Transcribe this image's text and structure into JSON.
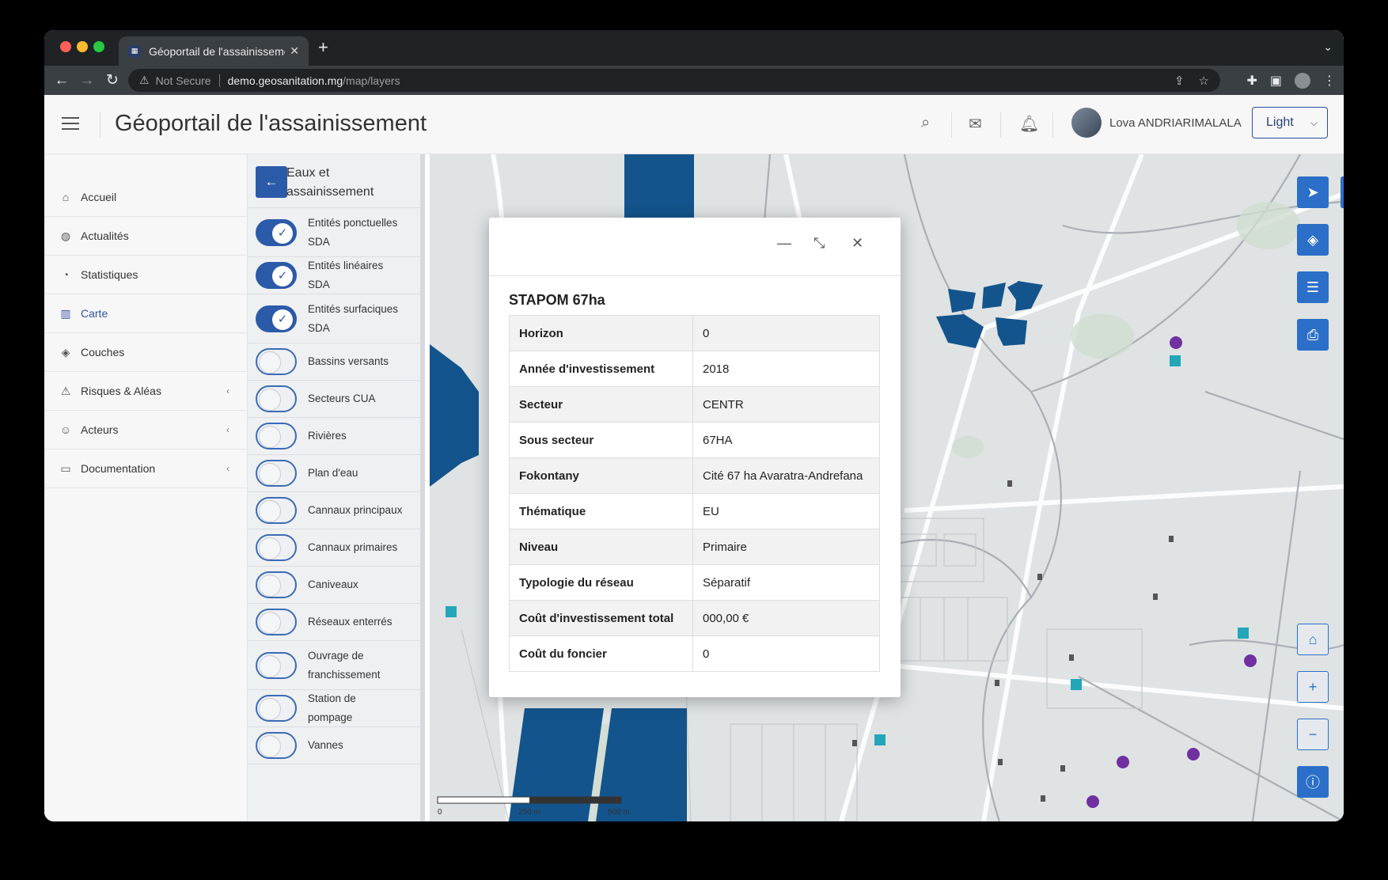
{
  "browser": {
    "tab_title": "Géoportail de l'assainissement",
    "security": "Not Secure",
    "url_host": "demo.geosanitation.mg",
    "url_path": "/map/layers"
  },
  "header": {
    "title": "Géoportail de l'assainissement",
    "user_name": "Lova ANDRIARIMALALA",
    "theme_label": "Light"
  },
  "sidebar": {
    "items": [
      {
        "label": "Accueil",
        "icon": "home-icon"
      },
      {
        "label": "Actualités",
        "icon": "globe-icon"
      },
      {
        "label": "Statistiques",
        "icon": "pie-chart-icon"
      },
      {
        "label": "Carte",
        "icon": "map-icon",
        "active": true
      },
      {
        "label": "Couches",
        "icon": "layers-icon"
      },
      {
        "label": "Risques & Aléas",
        "icon": "warning-icon",
        "expandable": true
      },
      {
        "label": "Acteurs",
        "icon": "users-icon",
        "expandable": true
      },
      {
        "label": "Documentation",
        "icon": "book-icon",
        "expandable": true
      }
    ]
  },
  "layer_panel": {
    "title": "Eaux et assainissement",
    "layers": [
      {
        "label": "Entités ponctuelles SDA",
        "enabled": true
      },
      {
        "label": "Entités linéaires SDA",
        "enabled": true
      },
      {
        "label": "Entités surfaciques SDA",
        "enabled": true
      },
      {
        "label": "Bassins versants",
        "enabled": false
      },
      {
        "label": "Secteurs CUA",
        "enabled": false
      },
      {
        "label": "Rivières",
        "enabled": false
      },
      {
        "label": "Plan d'eau",
        "enabled": false
      },
      {
        "label": "Cannaux principaux",
        "enabled": false
      },
      {
        "label": "Cannaux primaires",
        "enabled": false
      },
      {
        "label": "Caniveaux",
        "enabled": false
      },
      {
        "label": "Réseaux enterrés",
        "enabled": false
      },
      {
        "label": "Ouvrage de franchissement",
        "enabled": false
      },
      {
        "label": "Station de pompage",
        "enabled": false
      },
      {
        "label": "Vannes",
        "enabled": false
      }
    ]
  },
  "map": {
    "scale_labels": [
      "0",
      "250 m",
      "500 m"
    ],
    "feature_color": "#14548c"
  },
  "popup": {
    "title": "STAPOM 67ha",
    "rows": [
      {
        "key": "Horizon",
        "value": "0"
      },
      {
        "key": "Année d'investissement",
        "value": "2018"
      },
      {
        "key": "Secteur",
        "value": "CENTR"
      },
      {
        "key": "Sous secteur",
        "value": "67HA"
      },
      {
        "key": "Fokontany",
        "value": "Cité 67 ha Avaratra-Andrefana"
      },
      {
        "key": "Thématique",
        "value": "EU"
      },
      {
        "key": "Niveau",
        "value": "Primaire"
      },
      {
        "key": "Typologie du réseau",
        "value": "Séparatif"
      },
      {
        "key": "Coût d'investissement total",
        "value": "000,00 €"
      },
      {
        "key": "Coût du foncier",
        "value": "0"
      }
    ]
  }
}
